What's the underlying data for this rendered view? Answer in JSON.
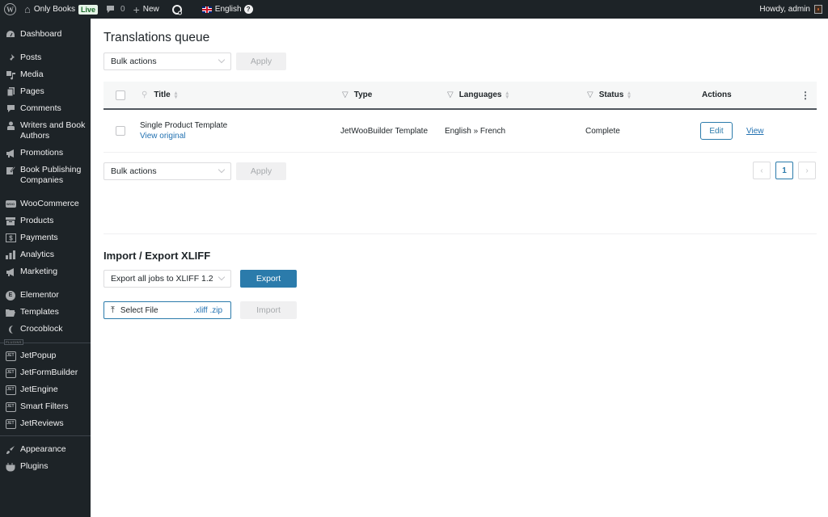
{
  "adminbar": {
    "site_name": "Only Books",
    "live_badge": "Live",
    "comments_count": "0",
    "new_label": "New",
    "language": "English",
    "help": "?",
    "greeting": "Howdy, admin"
  },
  "sidebar": {
    "items": [
      {
        "label": "Dashboard",
        "icon": "dashboard-icon"
      },
      {
        "label": "Posts",
        "icon": "pin-icon"
      },
      {
        "label": "Media",
        "icon": "media-icon"
      },
      {
        "label": "Pages",
        "icon": "pages-icon"
      },
      {
        "label": "Comments",
        "icon": "comment-icon"
      },
      {
        "label": "Writers and Book Authors",
        "icon": "user-icon"
      },
      {
        "label": "Promotions",
        "icon": "megaphone-icon"
      },
      {
        "label": "Book Publishing Companies",
        "icon": "edit-icon"
      },
      {
        "label": "WooCommerce",
        "icon": "woocommerce-icon"
      },
      {
        "label": "Products",
        "icon": "archive-icon"
      },
      {
        "label": "Payments",
        "icon": "dollar-icon"
      },
      {
        "label": "Analytics",
        "icon": "bar-chart-icon"
      },
      {
        "label": "Marketing",
        "icon": "megaphone-icon"
      },
      {
        "label": "Elementor",
        "icon": "elementor-icon"
      },
      {
        "label": "Templates",
        "icon": "folder-icon"
      },
      {
        "label": "Crocoblock",
        "icon": "crocoblock-icon"
      },
      {
        "label": "JetPopup",
        "icon": "jet-icon"
      },
      {
        "label": "JetFormBuilder",
        "icon": "jet-icon"
      },
      {
        "label": "JetEngine",
        "icon": "jet-icon"
      },
      {
        "label": "Smart Filters",
        "icon": "jet-icon"
      },
      {
        "label": "JetReviews",
        "icon": "jet-icon"
      },
      {
        "label": "Appearance",
        "icon": "brush-icon"
      },
      {
        "label": "Plugins",
        "icon": "plugin-icon"
      }
    ],
    "plugins_tag": "PLUGINS",
    "jet_glyph": "JET",
    "woo_glyph": "WOO"
  },
  "main": {
    "title": "Translations queue",
    "bulk_actions": "Bulk actions",
    "apply": "Apply",
    "table": {
      "columns": [
        "Title",
        "Type",
        "Languages",
        "Status",
        "Actions"
      ],
      "rows": [
        {
          "title": "Single Product Template",
          "view_original": "View original",
          "type": "JetWooBuilder Template",
          "languages": "English » French",
          "status": "Complete",
          "edit": "Edit",
          "view": "View"
        }
      ]
    },
    "pagination": {
      "prev": "‹",
      "current": "1",
      "next": "›"
    },
    "import_export": {
      "title": "Import / Export XLIFF",
      "export_select": "Export all jobs to XLIFF 1.2",
      "export_button": "Export",
      "select_file": "Select File",
      "extensions": ".xliff .zip",
      "import_button": "Import"
    }
  }
}
